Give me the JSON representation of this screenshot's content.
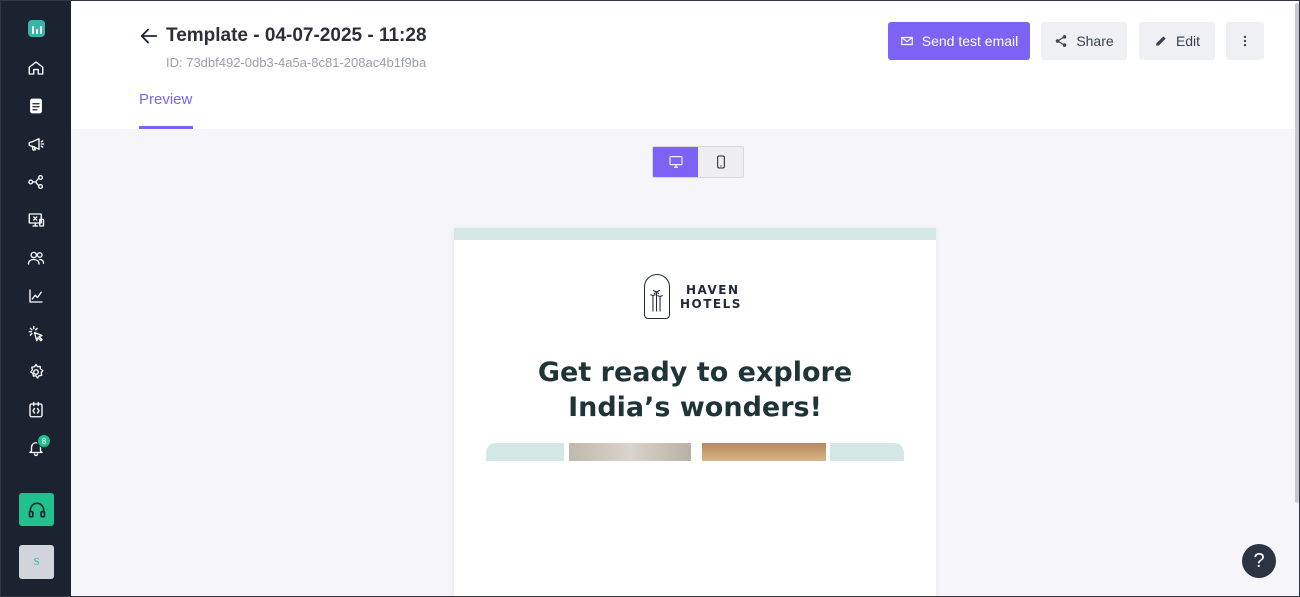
{
  "header": {
    "title": "Template - 04-07-2025 - 11:28",
    "id_text": "ID: 73dbf492-0db3-4a5a-8c81-208ac4b1f9ba",
    "buttons": {
      "send_test": "Send test email",
      "share": "Share",
      "edit": "Edit"
    },
    "tabs": [
      {
        "label": "Preview",
        "active": true
      }
    ]
  },
  "sidebar": {
    "items": [
      "home-icon",
      "templates-icon",
      "campaigns-icon",
      "flows-icon",
      "screens-icon",
      "audience-icon",
      "analytics-icon",
      "clicks-icon",
      "settings-icon",
      "code-icon",
      "notifications-icon"
    ],
    "notification_count": "8",
    "avatar_initial": "S"
  },
  "preview": {
    "device_modes": [
      "desktop",
      "mobile"
    ],
    "active_device": "desktop",
    "email": {
      "brand_line1": "HAVEN",
      "brand_line2": "HOTELS",
      "headline": "Get ready to explore India’s wonders!"
    }
  },
  "help": {
    "label": "?"
  },
  "colors": {
    "accent": "#7c63f5",
    "sidebar_bg": "#1c2330",
    "brand_green": "#21c18d",
    "email_band": "#d3e8e4"
  }
}
